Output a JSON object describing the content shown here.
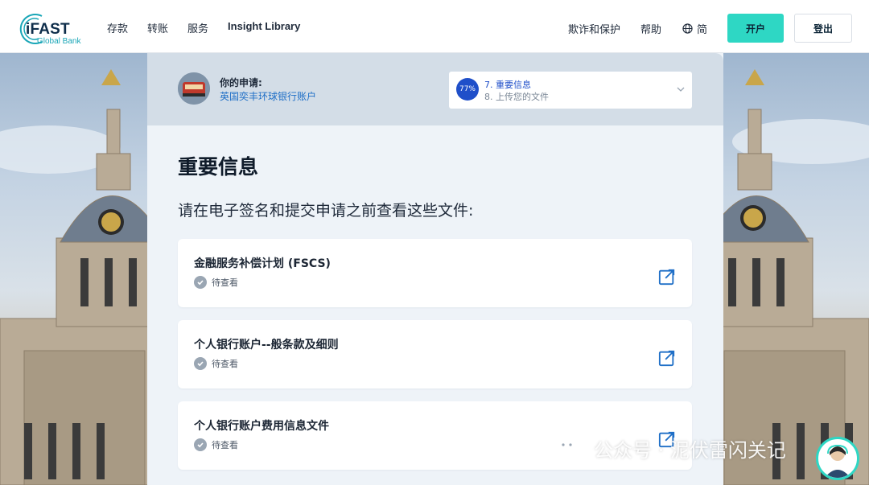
{
  "brand": {
    "name": "iFAST",
    "subtitle": "Global Bank"
  },
  "nav": {
    "left": [
      "存款",
      "转账",
      "服务",
      "Insight Library"
    ],
    "fraud": "欺诈和保护",
    "help": "帮助",
    "language": "简",
    "open_account": "开户",
    "login": "登出"
  },
  "application": {
    "label": "你的申请:",
    "value": "英国奕丰环球银行账户"
  },
  "progress": {
    "percent_label": "77%",
    "percent": 77,
    "current_step": "7. 重要信息",
    "next_step": "8. 上传您的文件"
  },
  "section": {
    "title": "重要信息",
    "intro": "请在电子签名和提交申请之前查看这些文件:"
  },
  "documents": [
    {
      "title": "金融服务补偿计划 (FSCS)",
      "status": "待查看"
    },
    {
      "title": "个人银行账户--般条款及细则",
      "status": "待查看"
    },
    {
      "title": "个人银行账户费用信息文件",
      "status": "待查看"
    }
  ],
  "watermark": {
    "text": "公众号 · 泥伏雷闪关记"
  },
  "colors": {
    "accent_teal": "#2ed7c4",
    "link_blue": "#1f6fc7",
    "step_blue": "#1f4fc9",
    "panel_bg": "#eef3f8",
    "panel_head": "#d3dde7"
  }
}
